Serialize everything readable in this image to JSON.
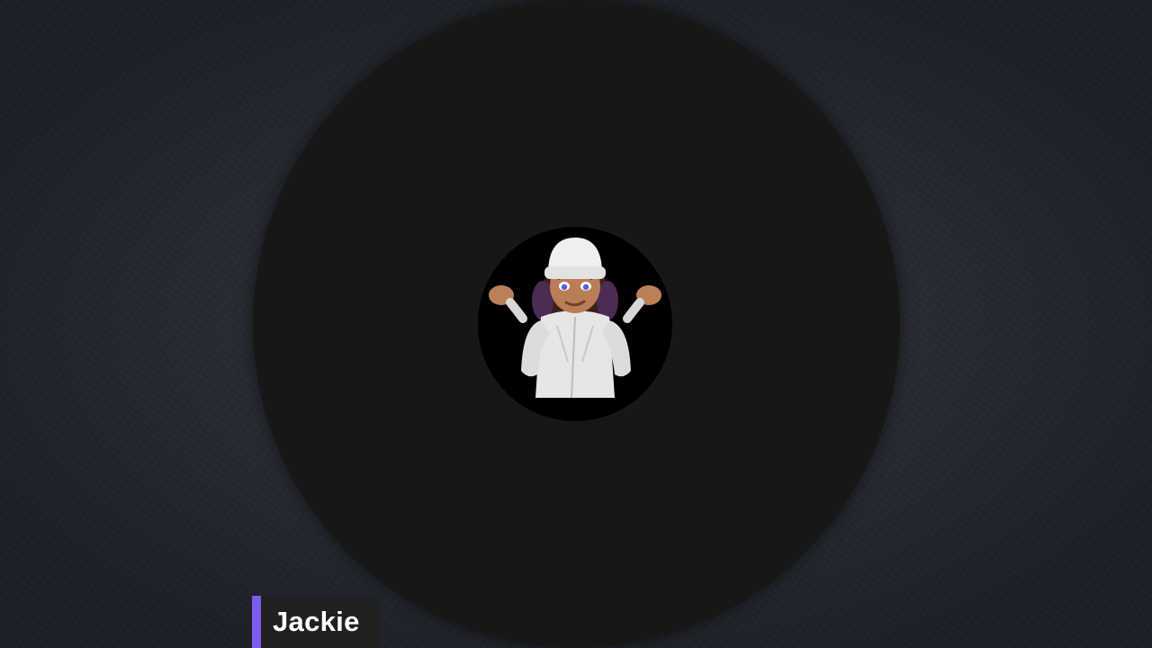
{
  "participant": {
    "name": "Jackie",
    "avatar_icon": "memoji-shrug-avatar-icon"
  },
  "colors": {
    "background": "#2a2f37",
    "stage": "#171717",
    "accent": "#7b5cf0",
    "nameplate": "#202020"
  }
}
